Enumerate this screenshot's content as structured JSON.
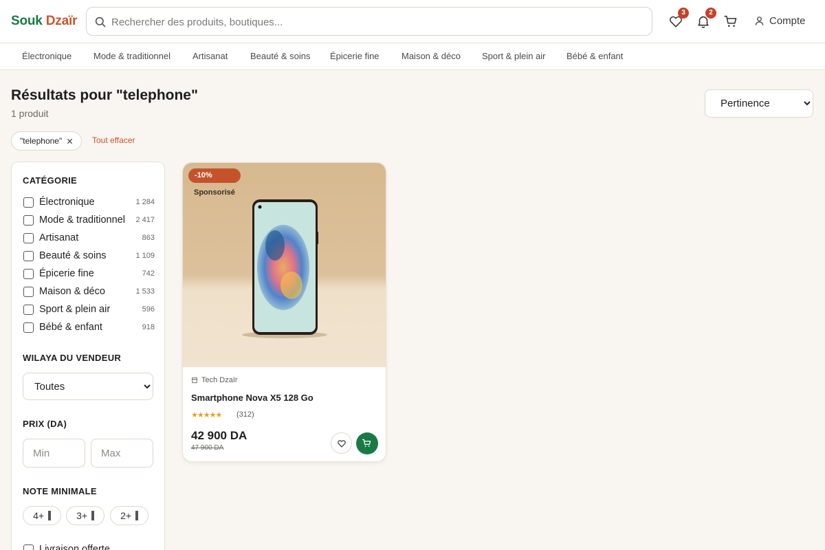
{
  "brand": {
    "part1": "Souk",
    "part2": "Dzaïr"
  },
  "search": {
    "placeholder": "Rechercher des produits, boutiques...",
    "value": ""
  },
  "header": {
    "wishlist_count": "3",
    "notifications_count": "2",
    "account_label": "Compte"
  },
  "category_nav": [
    "Électronique",
    "Mode & traditionnel",
    "Artisanat",
    "Beauté & soins",
    "Épicerie fine",
    "Maison & déco",
    "Sport & plein air",
    "Bébé & enfant"
  ],
  "results": {
    "title": "Résultats pour \"telephone\"",
    "count": "1 produit",
    "sort_selected": "Pertinence",
    "active_filter": "\"telephone\"",
    "clear_all": "Tout effacer"
  },
  "filters": {
    "category_title": "CATÉGORIE",
    "categories": [
      {
        "label": "Électronique",
        "count": "1 284"
      },
      {
        "label": "Mode & traditionnel",
        "count": "2 417"
      },
      {
        "label": "Artisanat",
        "count": "863"
      },
      {
        "label": "Beauté & soins",
        "count": "1 109"
      },
      {
        "label": "Épicerie fine",
        "count": "742"
      },
      {
        "label": "Maison & déco",
        "count": "1 533"
      },
      {
        "label": "Sport & plein air",
        "count": "596"
      },
      {
        "label": "Bébé & enfant",
        "count": "918"
      }
    ],
    "wilaya_title": "WILAYA DU VENDEUR",
    "wilaya_selected": "Toutes",
    "price_title": "PRIX (DA)",
    "price_min_placeholder": "Min",
    "price_max_placeholder": "Max",
    "rating_title": "NOTE MINIMALE",
    "rating_options": [
      "4+",
      "3+",
      "2+"
    ],
    "free_delivery_label": "Livraison offerte"
  },
  "product": {
    "discount": "-10%",
    "sponsored": "Sponsorisé",
    "seller": "Tech Dzaïr",
    "name": "Smartphone Nova X5 128 Go",
    "rating": 4.5,
    "stars": "★★★★★",
    "reviews": "(312)",
    "price": "42 900 DA",
    "old_price": "47 900 DA"
  },
  "colors": {
    "brand_green": "#1a7a45",
    "brand_orange": "#c9552e",
    "badge_red": "#c4432a",
    "star_gold": "#e4a11b",
    "page_bg": "#f9f5f0"
  },
  "icons": {
    "search": "search-icon",
    "wishlist": "heart-icon",
    "notifications": "bell-icon",
    "cart": "cart-icon",
    "account": "user-icon",
    "remove_filter": "close-icon",
    "seller": "store-icon",
    "add_to_cart": "cart-icon"
  }
}
